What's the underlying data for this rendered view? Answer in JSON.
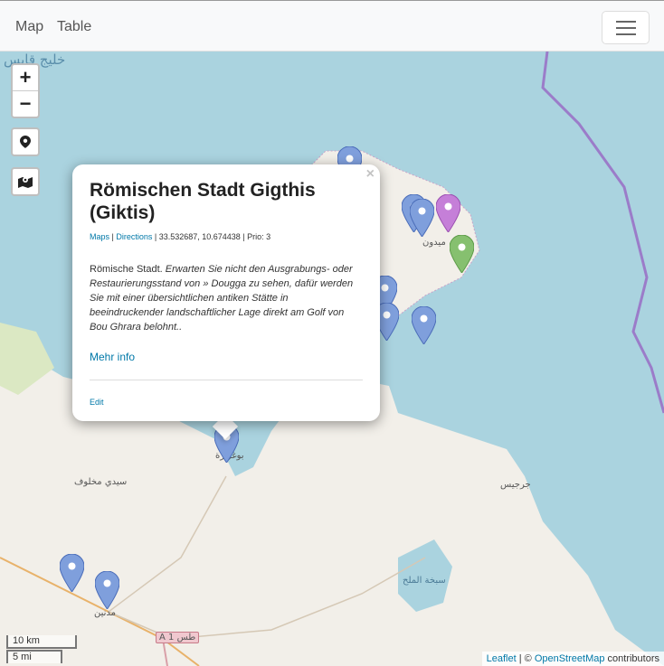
{
  "navbar": {
    "links": [
      "Map",
      "Table"
    ],
    "menu_icon": "hamburger-icon"
  },
  "map": {
    "controls": {
      "zoom_in": "+",
      "zoom_out": "−",
      "locate_icon": "location-pin-icon",
      "layers_icon": "map-marker-icon"
    },
    "labels": {
      "gulf": "خليج قابس",
      "midoun": "ميدون",
      "zarzis": "جرجيس",
      "boughrara": "بوغرارة",
      "sidi_makhlouf": "سيدي مخلوف",
      "medenine": "مدنين",
      "sebkha": "سبخة الملح",
      "road": "A 1 طس"
    },
    "scale": {
      "km": "10 km",
      "mi": "5 mi"
    },
    "attribution": {
      "leaflet": "Leaflet",
      "sep": " | © ",
      "osm": "OpenStreetMap",
      "suffix": " contributors"
    }
  },
  "popup": {
    "close": "×",
    "title": "Römischen Stadt Gigthis (Giktis)",
    "maps_link": "Maps",
    "directions_link": "Directions",
    "meta_rest": " | 33.532687, 10.674438 | Prio: 3",
    "desc_plain": "Römische Stadt. ",
    "desc_italic": "Erwarten Sie nicht den Ausgrabungs- oder Restaurierungsstand von » Dougga zu sehen, dafür werden Sie mit einer übersichtlichen antiken Stätte in beeindruckender landschaftlicher Lage direkt am Golf von Bou Ghrara belohnt..",
    "more": "Mehr info",
    "edit": "Edit"
  },
  "colors": {
    "water": "#aad3df",
    "land": "#f2efe9",
    "marker_blue": "#7f9fdc",
    "marker_purple": "#c57fd8",
    "marker_green": "#86c06f",
    "link": "#0078a8"
  }
}
